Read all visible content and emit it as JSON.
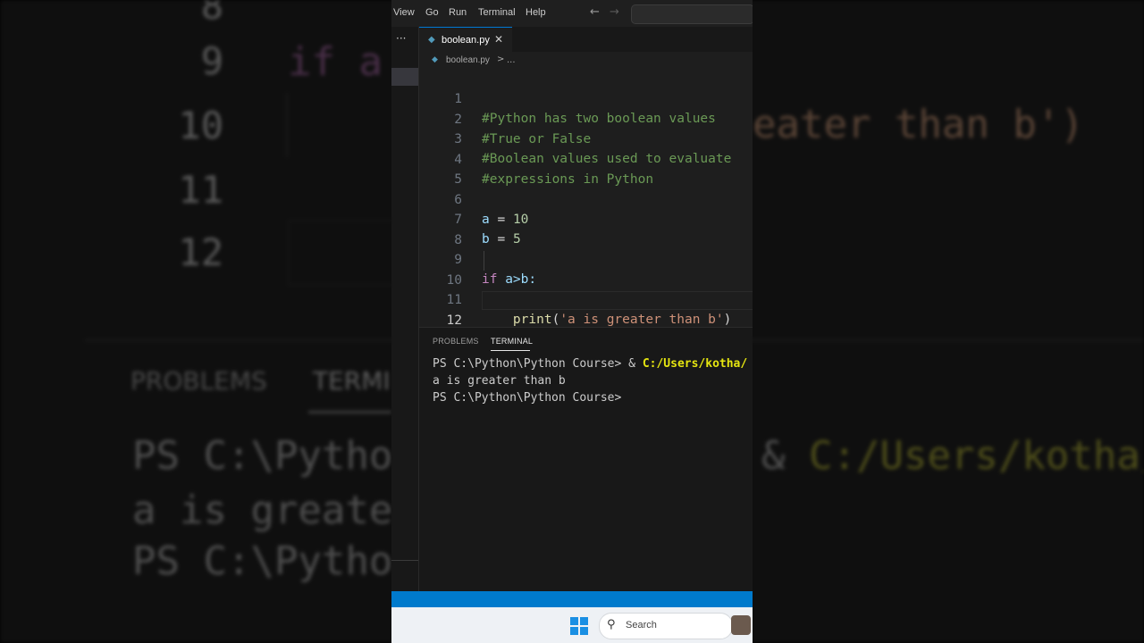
{
  "menu": {
    "items": [
      "View",
      "Go",
      "Run",
      "Terminal",
      "Help"
    ],
    "back_icon": "arrow-left-icon",
    "forward_icon": "arrow-right-icon"
  },
  "sidebar": {
    "more_label": "···"
  },
  "tab": {
    "filename": "boolean.py",
    "close_glyph": "✕",
    "file_icon": "python-file-icon"
  },
  "breadcrumb": {
    "file": "boolean.py",
    "separator": ">",
    "more": "..."
  },
  "editor": {
    "lines": [
      {
        "n": "1",
        "comment": "#Python has two boolean values"
      },
      {
        "n": "2",
        "comment": "#True or False"
      },
      {
        "n": "3",
        "comment": "#Boolean values used to evaluate"
      },
      {
        "n": "4",
        "comment": "#expressions in Python"
      },
      {
        "n": "5"
      },
      {
        "n": "6",
        "var": "a",
        "op": " = ",
        "value": "10"
      },
      {
        "n": "7",
        "var": "b",
        "op": " = ",
        "value": "5"
      },
      {
        "n": "8"
      },
      {
        "n": "9",
        "kw": "if",
        "cond": " a>b:"
      },
      {
        "n": "10",
        "indent": "    ",
        "fn": "print",
        "open": "(",
        "str": "'a is greater than b'",
        "close": ")"
      },
      {
        "n": "11"
      },
      {
        "n": "12"
      }
    ]
  },
  "panel": {
    "tabs": {
      "problems": "PROBLEMS",
      "terminal": "TERMINAL"
    },
    "terminal": {
      "line1_prompt": "PS C:\\Python\\Python Course> & ",
      "line1_path": "C:/Users/kotha/",
      "line2": "a is greater than b",
      "line3": "PS C:\\Python\\Python Course>"
    }
  },
  "taskbar": {
    "search_label": "Search",
    "windows_icon": "windows-start-icon"
  },
  "background": {
    "code9": "if a",
    "code10_tail": "eater than b')",
    "tab_problems": "PROBLEMS",
    "tab_terminal": "TERMI",
    "term1_left": "PS C:\\Pythor",
    "term1_right_amp": "&",
    "term1_right_path": "C:/Users/kotha/",
    "term2": "a is greater",
    "term3": "PS C:\\Pythor",
    "ln": [
      "8",
      "9",
      "10",
      "11",
      "12"
    ]
  }
}
